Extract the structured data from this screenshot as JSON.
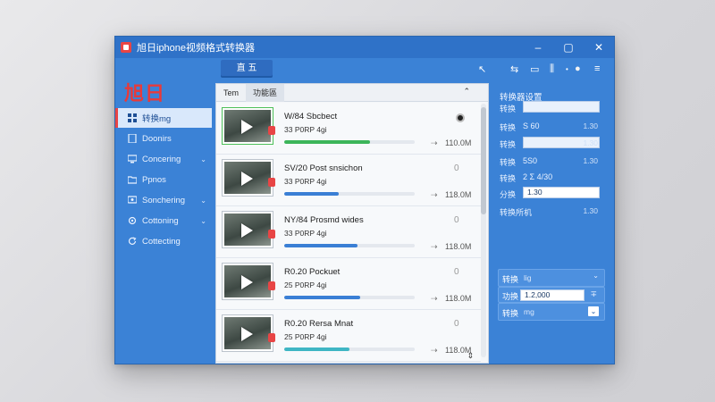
{
  "window": {
    "title": "旭日iphone视频格式转换器",
    "controls": [
      "–",
      "▢",
      "✕"
    ]
  },
  "sidebar": {
    "logo": "旭日",
    "items": [
      {
        "label": "转换mg",
        "icon": "grid-icon",
        "active": true,
        "chevron": false
      },
      {
        "label": "Doonirs",
        "icon": "document-icon",
        "active": false,
        "chevron": false
      },
      {
        "label": "Concering",
        "icon": "monitor-icon",
        "active": false,
        "chevron": true
      },
      {
        "label": "Ppnos",
        "icon": "folder-icon",
        "active": false,
        "chevron": false
      },
      {
        "label": "Sonchering",
        "icon": "sync-icon",
        "active": false,
        "chevron": true
      },
      {
        "label": "Cottoning",
        "icon": "settings-icon",
        "active": false,
        "chevron": true
      },
      {
        "label": "Cottecting",
        "icon": "refresh-icon",
        "active": false,
        "chevron": false
      }
    ]
  },
  "toolbar": {
    "tab_label": "直 五",
    "tools": [
      "↖",
      "⇆",
      "▭",
      "⫼",
      "•",
      "●",
      "≡"
    ]
  },
  "list": {
    "headers": [
      "Tem",
      "功能區"
    ],
    "header_caret": "⌃",
    "items": [
      {
        "title": "W/84 Sbcbect",
        "meta": "33 P0RP 4gi",
        "progress": 0.66,
        "color": "#3cb55a",
        "size": "110.0M",
        "status": "dot"
      },
      {
        "title": "SV/20 Post snsichon",
        "meta": "33 P0RP 4gi",
        "progress": 0.42,
        "color": "#3a7fd5",
        "size": "118.0M",
        "status": "0"
      },
      {
        "title": "NY/84 Prosmd wides",
        "meta": "33 P0RP 4gi",
        "progress": 0.56,
        "color": "#3a7fd5",
        "size": "118.0M",
        "status": "0"
      },
      {
        "title": "R0.20 Pockuet",
        "meta": "25 P0RP 4gi",
        "progress": 0.58,
        "color": "#3a7fd5",
        "size": "118.0M",
        "status": "0"
      },
      {
        "title": "R0.20 Rersa Mnat",
        "meta": "25 P0RP 4gi",
        "progress": 0.5,
        "color": "#3fb6c4",
        "size": "118.0M",
        "status": "0"
      }
    ],
    "partial_title": "ℨ110 ≡≡≡≡"
  },
  "settings": {
    "title": "转换器设置",
    "rows": [
      {
        "label": "转换",
        "value": "",
        "input": ""
      },
      {
        "label": "转换",
        "value": "1.30",
        "input": "S 60"
      },
      {
        "label": "转换",
        "value": "1.30",
        "input": ""
      },
      {
        "label": "转换",
        "value": "1.30",
        "input": "5S0"
      },
      {
        "label": "转换",
        "value": "",
        "input": "2 Σ 4/30"
      },
      {
        "label": "分换",
        "value": "",
        "input": "1.30"
      },
      {
        "label": "转换所机",
        "value": "1.30",
        "input": ""
      }
    ],
    "select1_label": "转换",
    "select1_value": "lig",
    "select2_label": "功换",
    "select2_value": "1.2,000",
    "select2_icon": "∓",
    "select3_label": "转换",
    "select3_value": "mg"
  }
}
